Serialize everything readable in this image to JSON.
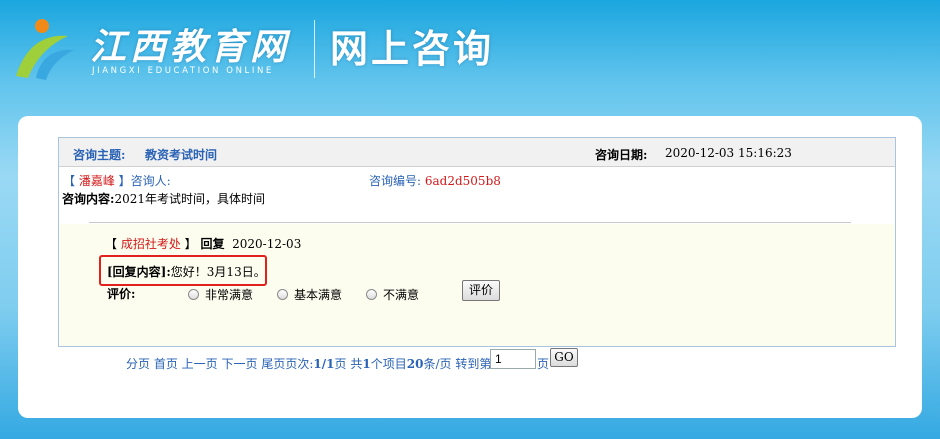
{
  "banner": {
    "logo_cn": "江西教育网",
    "logo_en": "JIANGXI EDUCATION ONLINE",
    "section_title": "网上咨询"
  },
  "consult": {
    "topic_label": "咨询主题:",
    "topic_value": "教资考试时间",
    "date_label": "咨询日期:",
    "date_value": "2020-12-03 15:16:23",
    "asker_name": "潘嘉峰",
    "asker_label": "咨询人:",
    "number_label": "咨询编号:",
    "number_value": "6ad2d505b8",
    "content_label": "咨询内容:",
    "content_value": "2021年考试时间，具体时间"
  },
  "reply": {
    "department": "成招社考处",
    "reply_label": "回复",
    "reply_date": "2020-12-03",
    "content_label": "[回复内容]:",
    "content_value": "您好！3月13日。",
    "rating_label": "评价:",
    "options": [
      "非常满意",
      "基本满意",
      "不满意"
    ],
    "rate_button": "评价"
  },
  "pager": {
    "first": "分页 首页",
    "prev": "上一页",
    "next": "下一页",
    "last": "尾页",
    "pages_label": "页次:",
    "pages_value": "1/1",
    "pages_unit": "页",
    "total_prefix": "共",
    "total_count": "1",
    "total_unit": "个项目",
    "per_page": "20",
    "per_page_unit": "条/页",
    "goto_label": "转到第",
    "goto_value": "1",
    "goto_suffix": "页",
    "go_button": "GO"
  },
  "colors": {
    "link_blue": "#2a63b5",
    "name_red": "#d21a1a",
    "highlight_red": "#e0211e"
  }
}
